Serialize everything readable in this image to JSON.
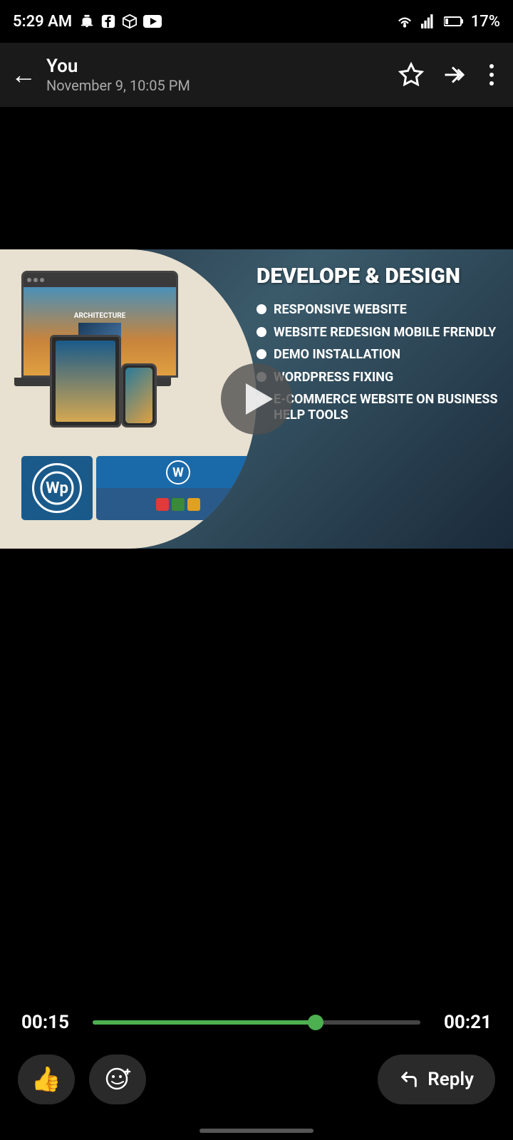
{
  "statusBar": {
    "time": "5:29 AM",
    "battery": "17%",
    "icons": [
      "notification",
      "facebook",
      "game",
      "youtube",
      "wifi",
      "signal",
      "battery"
    ]
  },
  "header": {
    "sender": "You",
    "date": "November 9, 10:05 PM",
    "backLabel": "←",
    "starLabel": "☆",
    "forwardLabel": "⇉",
    "menuLabel": "⋮"
  },
  "video": {
    "title": "DEVELOPE & DESIGN",
    "features": [
      "RESPONSIVE WEBSITE",
      "WEBSITE REDESIGN MOBILE FRENDLY",
      "DEMO INSTALLATION",
      "WORDPRESS FIXING",
      "E-COMMERCE WEBSITE ON BUSINESS HELP TOOLS"
    ]
  },
  "player": {
    "currentTime": "00:15",
    "totalTime": "00:21",
    "progressPercent": 68
  },
  "toolbar": {
    "thumbsUpLabel": "👍",
    "emojiLabel": "😊",
    "replyLabel": "Reply"
  }
}
